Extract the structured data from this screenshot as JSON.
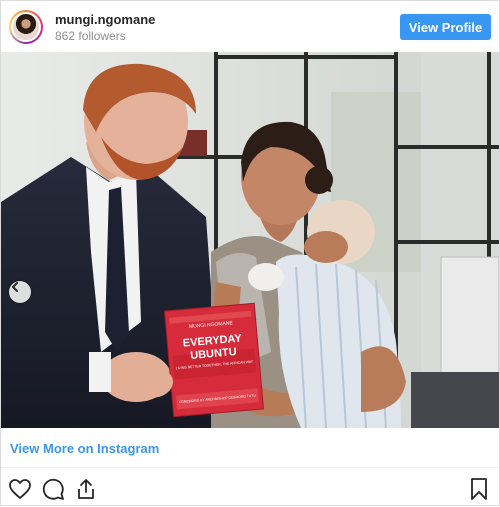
{
  "profile": {
    "username": "mungi.ngomane",
    "followers": "862 followers",
    "view_profile_label": "View Profile",
    "avatar_icon": "profile-avatar"
  },
  "post": {
    "image_alt": "Photo: man in dark suit holding a red book beside a woman holding a baby",
    "book": {
      "author_line": "MUNGI NGOMANE",
      "title_line1": "EVERYDAY",
      "title_line2": "UBUNTU",
      "subtitle": "LIVING BETTER TOGETHER, THE AFRICAN WAY",
      "foreword": "FOREWORD BY ARCHBISHOP DESMOND TUTU"
    },
    "carousel_prev_icon": "chevron-left-icon"
  },
  "footer": {
    "view_more_label": "View More on Instagram",
    "actions": {
      "like_icon": "heart-icon",
      "comment_icon": "comment-icon",
      "share_icon": "share-icon",
      "save_icon": "bookmark-icon"
    }
  },
  "colors": {
    "accent": "#3897f0",
    "book_red": "#d62b3a",
    "border": "#dbdbdb"
  }
}
